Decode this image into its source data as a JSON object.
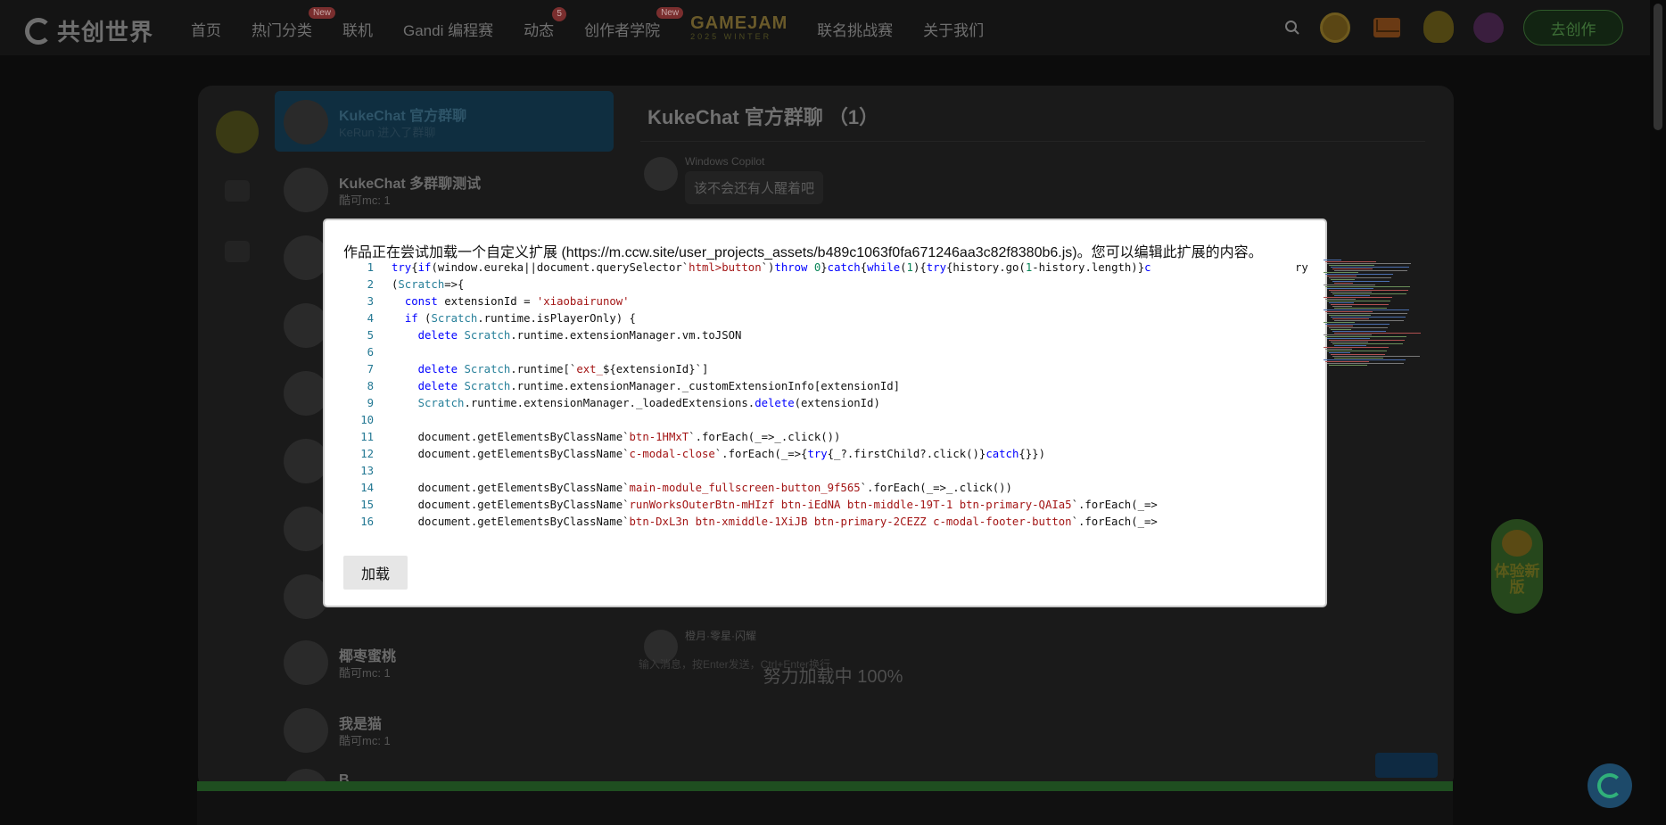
{
  "nav": {
    "logo_text": "共创世界",
    "items": [
      {
        "label": "首页"
      },
      {
        "label": "热门分类",
        "badge": "New"
      },
      {
        "label": "联机"
      },
      {
        "label": "Gandi 编程赛"
      },
      {
        "label": "动态",
        "badge": "5"
      },
      {
        "label": "创作者学院",
        "badge": "New"
      }
    ],
    "gamejam_title": "GAMEJAM",
    "gamejam_sub": "2025 WINTER",
    "items_after": [
      {
        "label": "联名挑战赛"
      },
      {
        "label": "关于我们"
      }
    ],
    "create_button": "去创作"
  },
  "chat": {
    "conversations": [
      {
        "name": "KukeChat 官方群聊",
        "sub": "KeRun 进入了群聊",
        "active": true
      },
      {
        "name": "KukeChat 多群聊测试",
        "sub": "酷可mc: 1",
        "active": false
      },
      {
        "name": "椰枣蜜桃",
        "sub": "酷可mc: 1",
        "active": false
      },
      {
        "name": "我是猫",
        "sub": "酷可mc: 1",
        "active": false
      },
      {
        "name": "B...",
        "sub": "",
        "active": false
      }
    ],
    "title": "KukeChat 官方群聊 （1）",
    "messages": [
      {
        "author": "Windows Copilot",
        "text": "该不会还有人醒着吧"
      },
      {
        "author": "橙月·零星·闪耀",
        "text": ""
      }
    ],
    "input_placeholder": "输入消息，按Enter发送，Ctrl+Enter换行"
  },
  "loading_text": "努力加载中 100%",
  "try_badge": "体验新版",
  "modal": {
    "message": "作品正在尝试加载一个自定义扩展 (https://m.ccw.site/user_projects_assets/b489c1063f0fa671246aa3c82f8380b6.js)。您可以编辑此扩展的内容。",
    "load_button": "加载",
    "minimap_overflow": "ry",
    "code_lines": [
      {
        "n": "1",
        "html": "<span class='k'>try</span>{<span class='k'>if</span>(window.eureka||document.querySelector`<span class='s'>html&gt;button</span>`)<span class='k'>throw</span> <span class='n'>0</span>}<span class='k'>catch</span>{<span class='k'>while</span>(<span class='n'>1</span>){<span class='k'>try</span>{history.go(<span class='n'>1</span>-history.length)}<span class='k'>c</span>"
      },
      {
        "n": "2",
        "html": "(<span class='t'>Scratch</span>=&gt;{"
      },
      {
        "n": "3",
        "html": "  <span class='k'>const</span> extensionId = <span class='s'>'xiaobairunow'</span>"
      },
      {
        "n": "4",
        "html": "  <span class='k'>if</span> (<span class='t'>Scratch</span>.runtime.isPlayerOnly) {"
      },
      {
        "n": "5",
        "html": "    <span class='k'>delete</span> <span class='t'>Scratch</span>.runtime.extensionManager.vm.toJSON"
      },
      {
        "n": "6",
        "html": ""
      },
      {
        "n": "7",
        "html": "    <span class='k'>delete</span> <span class='t'>Scratch</span>.runtime[`<span class='s'>ext_</span>${extensionId}`]"
      },
      {
        "n": "8",
        "html": "    <span class='k'>delete</span> <span class='t'>Scratch</span>.runtime.extensionManager._customExtensionInfo[extensionId]"
      },
      {
        "n": "9",
        "html": "    <span class='t'>Scratch</span>.runtime.extensionManager._loadedExtensions.<span class='k'>delete</span>(extensionId)"
      },
      {
        "n": "10",
        "html": ""
      },
      {
        "n": "11",
        "html": "    document.getElementsByClassName`<span class='s'>btn-1HMxT</span>`.forEach(_=&gt;_.click())"
      },
      {
        "n": "12",
        "html": "    document.getElementsByClassName`<span class='s'>c-modal-close</span>`.forEach(_=&gt;{<span class='k'>try</span>{_?.firstChild?.click()}<span class='k'>catch</span>{}})"
      },
      {
        "n": "13",
        "html": ""
      },
      {
        "n": "14",
        "html": "    document.getElementsByClassName`<span class='s'>main-module_fullscreen-button_9f565</span>`.forEach(_=&gt;_.click())"
      },
      {
        "n": "15",
        "html": "    document.getElementsByClassName`<span class='s'>runWorksOuterBtn-mHIzf btn-iEdNA btn-middle-19T-1 btn-primary-QAIa5</span>`.forEach(_=&gt;"
      },
      {
        "n": "16",
        "html": "    document.getElementsByClassName`<span class='s'>btn-DxL3n btn-xmiddle-1XiJB btn-primary-2CEZZ c-modal-footer-button</span>`.forEach(_=&gt;"
      }
    ]
  },
  "colors": {
    "keyword": "#0000ff",
    "string": "#a31515",
    "number": "#098658",
    "type": "#267f99",
    "line_number": "#237893",
    "progress": "#1f4e20",
    "create_button_text": "#3d6e36"
  },
  "icons": [
    "search-icon",
    "coin-icon",
    "mail-icon",
    "glasses-icon",
    "user-avatar"
  ]
}
